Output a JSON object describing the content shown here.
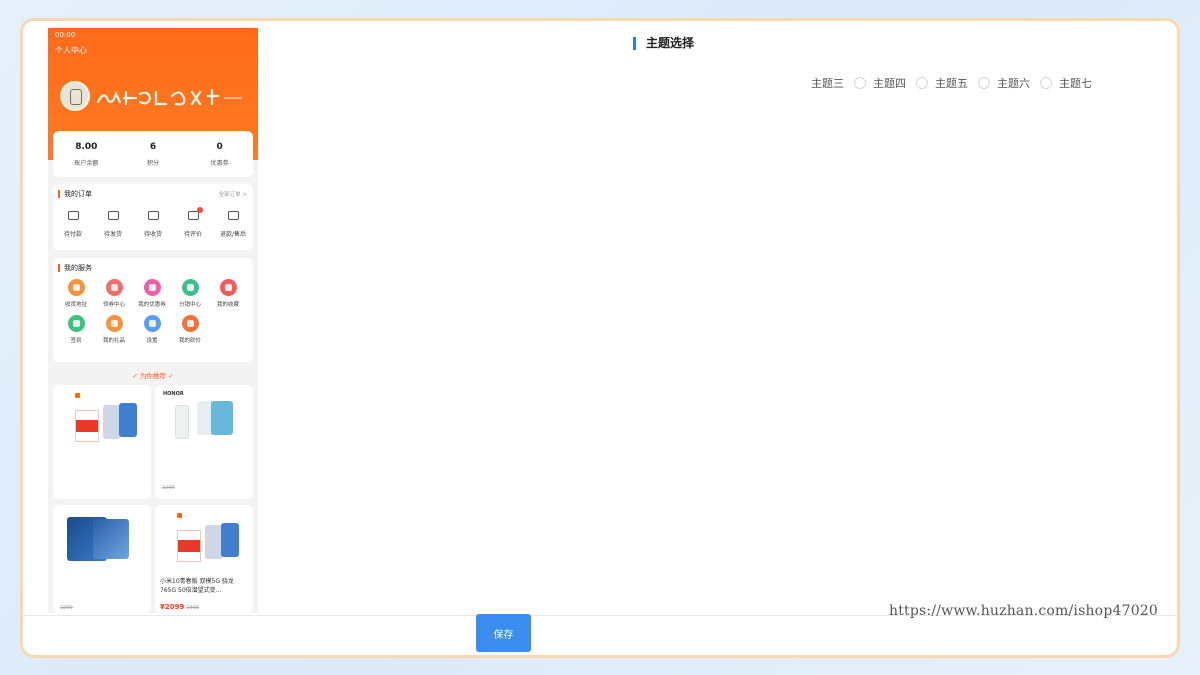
{
  "phone": {
    "status_time": "00:00",
    "page_title": "个人中心",
    "stats": [
      {
        "value": "8.00",
        "label": "账户余额"
      },
      {
        "value": "6",
        "label": "积分"
      },
      {
        "value": "0",
        "label": "优惠券"
      }
    ],
    "orders": {
      "title": "我的订单",
      "more": "全部订单 >",
      "items": [
        {
          "label": "待付款",
          "icon": "wallet-icon"
        },
        {
          "label": "待发货",
          "icon": "package-icon"
        },
        {
          "label": "待收货",
          "icon": "truck-icon"
        },
        {
          "label": "待评价",
          "icon": "comment-icon",
          "badge": true
        },
        {
          "label": "退款/售后",
          "icon": "refund-icon"
        }
      ]
    },
    "services": {
      "title": "我的服务",
      "items": [
        {
          "label": "收货地址",
          "color": "#f7933a"
        },
        {
          "label": "领券中心",
          "color": "#f56b6b"
        },
        {
          "label": "我的优惠券",
          "color": "#ee5fa5"
        },
        {
          "label": "分销中心",
          "color": "#3fbf8f"
        },
        {
          "label": "我的收藏",
          "color": "#f25c5c"
        },
        {
          "label": "签到",
          "color": "#3cc47c"
        },
        {
          "label": "我的礼品",
          "color": "#f7933a"
        },
        {
          "label": "设置",
          "color": "#5b9cf5"
        },
        {
          "label": "我的砍价",
          "color": "#f5713a"
        }
      ]
    },
    "recommend_title": "✓ 为你推荐 ✓",
    "products": [
      {
        "brand": "",
        "name": "",
        "price": "",
        "old_price": ""
      },
      {
        "brand": "HONOR",
        "name": "",
        "price": "",
        "old_price": "2299"
      },
      {
        "brand": "",
        "name": "",
        "price": "",
        "old_price": "2299"
      },
      {
        "brand": "",
        "name": "小米10青春版 双模5G 骁龙765G 50倍潜望式变...",
        "price": "¥2099",
        "old_price": "2399"
      }
    ]
  },
  "theme_section": {
    "title": "主题选择",
    "options": [
      "主题三",
      "主题四",
      "主题五",
      "主题六",
      "主题七"
    ]
  },
  "save_button": "保存",
  "watermark": "https://www.huzhan.com/ishop47020"
}
